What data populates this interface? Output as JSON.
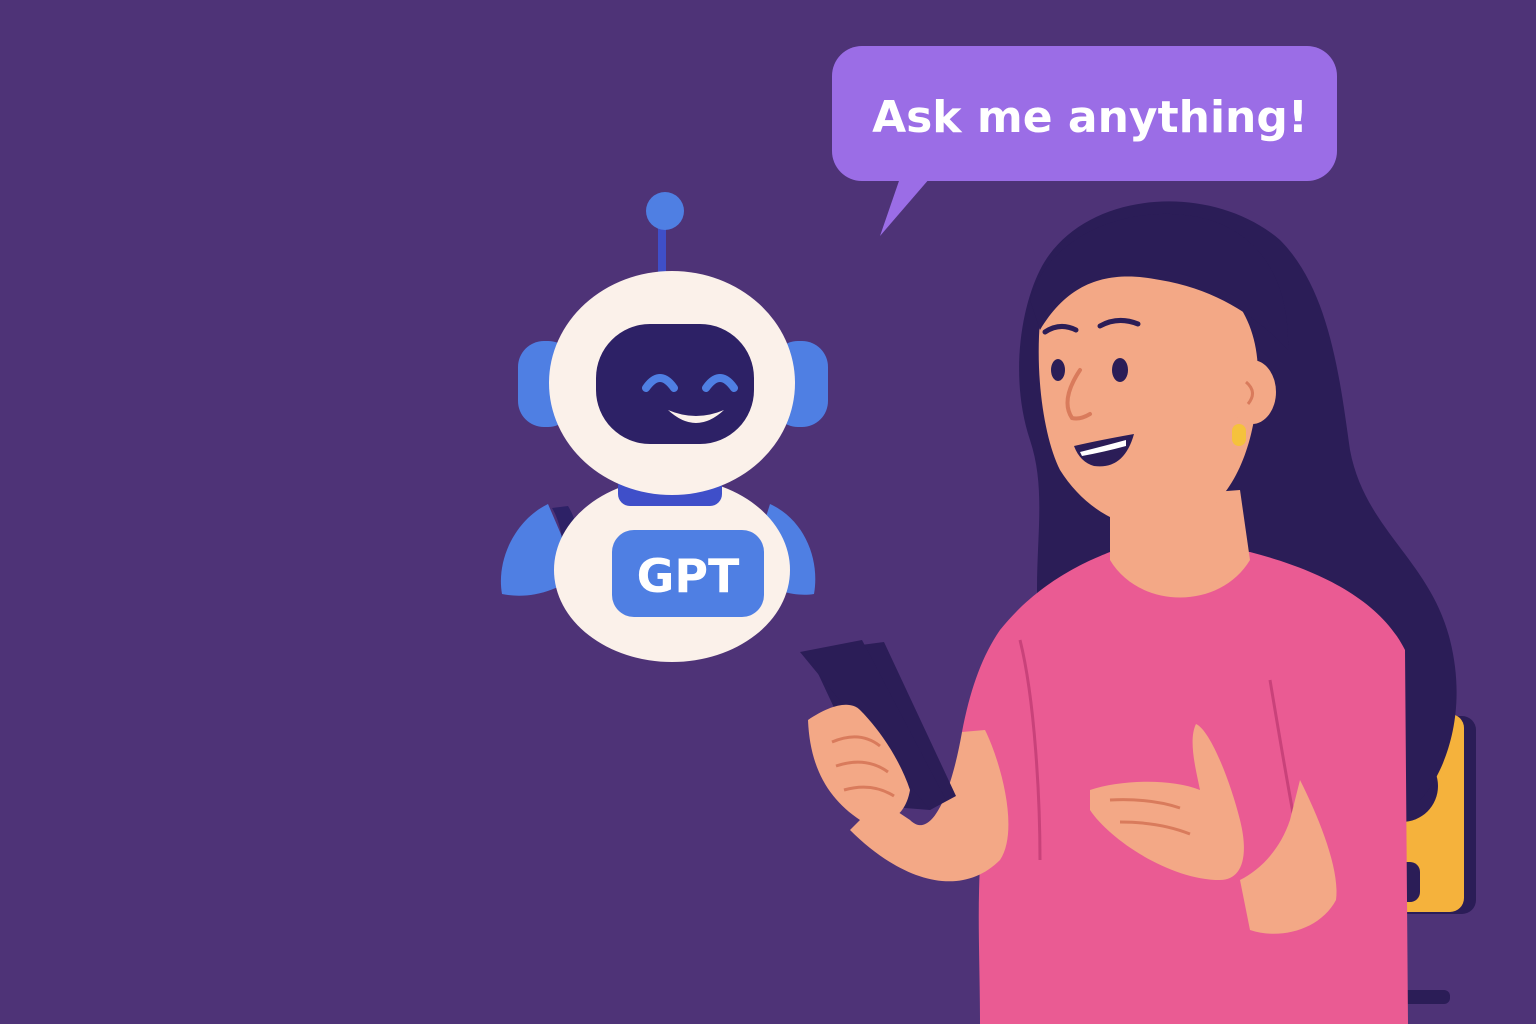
{
  "speech_bubble": {
    "text": "Ask me anything!"
  },
  "robot": {
    "badge_text": "GPT"
  },
  "icons": {
    "robot": "robot-icon",
    "person": "woman-with-phone",
    "phone": "smartphone-icon",
    "speaker": "smart-speaker-icon"
  },
  "colors": {
    "background": "#4e3377",
    "bubble": "#9b6de6",
    "robot_body": "#fbf1ea",
    "robot_accent": "#4f7fe3",
    "robot_visor": "#2d2166",
    "shirt": "#ea5b93",
    "skin": "#f3a886",
    "hair": "#2b1d57",
    "speaker": "#f5b23c"
  }
}
